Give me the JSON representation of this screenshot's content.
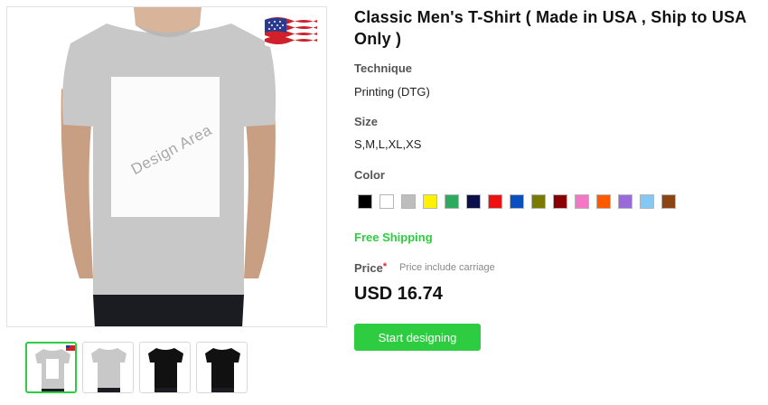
{
  "product": {
    "title": "Classic Men's T-Shirt ( Made in USA , Ship to USA Only )",
    "design_area_label": "Design Area",
    "flag_icon": "us-flag-icon"
  },
  "technique": {
    "label": "Technique",
    "value": "Printing (DTG)"
  },
  "size": {
    "label": "Size",
    "value": "S,M,L,XL,XS"
  },
  "color": {
    "label": "Color",
    "swatches": [
      "#000000",
      "#ffffff",
      "#bdbdbd",
      "#fff200",
      "#2eaa5f",
      "#0b0f4a",
      "#ee1111",
      "#0b4fbf",
      "#7a7a00",
      "#8a0000",
      "#f477c6",
      "#ff5a00",
      "#9a6ad9",
      "#86c8f4",
      "#8b4513"
    ]
  },
  "shipping": {
    "text": "Free Shipping",
    "color": "#2ecc40"
  },
  "price": {
    "label": "Price",
    "required_mark": "*",
    "note": "Price include carriage",
    "value": "USD 16.74"
  },
  "actions": {
    "start_label": "Start designing"
  },
  "thumbnails": [
    {
      "shirt_color": "#c8c8c8",
      "active": true
    },
    {
      "shirt_color": "#c8c8c8",
      "active": false
    },
    {
      "shirt_color": "#111111",
      "active": false
    },
    {
      "shirt_color": "#111111",
      "active": false
    }
  ]
}
